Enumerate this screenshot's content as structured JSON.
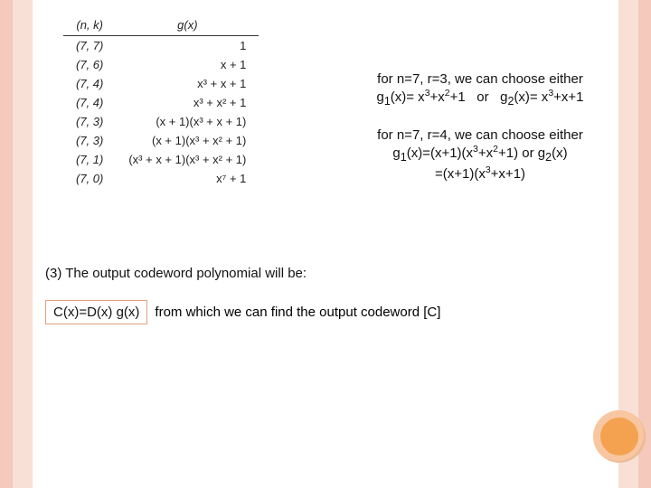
{
  "table": {
    "headers": {
      "col1": "(n, k)",
      "col2": "g(x)"
    },
    "rows": [
      {
        "nk": "(7, 7)",
        "g": "1"
      },
      {
        "nk": "(7, 6)",
        "g": "x + 1"
      },
      {
        "nk": "(7, 4)",
        "g": "x³ + x + 1"
      },
      {
        "nk": "(7, 4)",
        "g": "x³ + x² + 1"
      },
      {
        "nk": "(7, 3)",
        "g": "(x + 1)(x³ + x + 1)"
      },
      {
        "nk": "(7, 3)",
        "g": "(x + 1)(x³ + x² + 1)"
      },
      {
        "nk": "(7, 1)",
        "g": "(x³ + x + 1)(x³ + x² + 1)"
      },
      {
        "nk": "(7, 0)",
        "g": "x⁷ + 1"
      }
    ]
  },
  "note1": {
    "line1": "for n=7, r=3, we can choose either",
    "line2_html": "g<sub>1</sub>(x)= x<sup>3</sup>+x<sup>2</sup>+1&nbsp;&nbsp; or&nbsp;&nbsp; g<sub>2</sub>(x)= x<sup>3</sup>+x+1"
  },
  "note2": {
    "line1": "for n=7, r=4, we can choose either",
    "line2_html": "g<sub>1</sub>(x)=(x+1)(x<sup>3</sup>+x<sup>2</sup>+1) or g<sub>2</sub>(x)",
    "line3_html": "=(x+1)(x<sup>3</sup>+x+1)"
  },
  "section3": "(3) The output codeword polynomial will be:",
  "formula": "C(x)=D(x) g(x)",
  "formula_rest": "from which we can find the output codeword [C]"
}
